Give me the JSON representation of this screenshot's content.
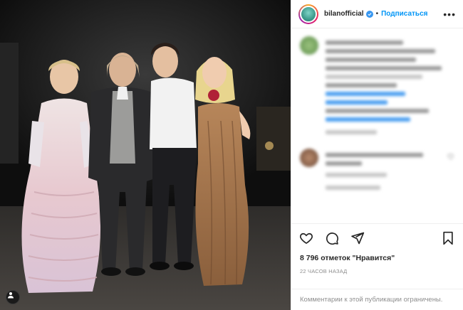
{
  "post": {
    "username": "bilanofficial",
    "separator": "•",
    "follow_label": "Подписаться",
    "more_label": "•••",
    "likes_text": "8 796 отметок \"Нравится\"",
    "time_text": "22 ЧАСОВ НАЗАД",
    "comments_limited_text": "Комментарии к этой публикации ограничены."
  },
  "colors": {
    "accent": "#0095f6",
    "verified": "#3897f0",
    "muted": "#8e8e8e"
  },
  "icons": {
    "verified": "verified-badge-icon",
    "like": "heart-icon",
    "comment": "comment-bubble-icon",
    "share": "paper-plane-icon",
    "save": "bookmark-icon",
    "tag": "user-tag-icon"
  }
}
